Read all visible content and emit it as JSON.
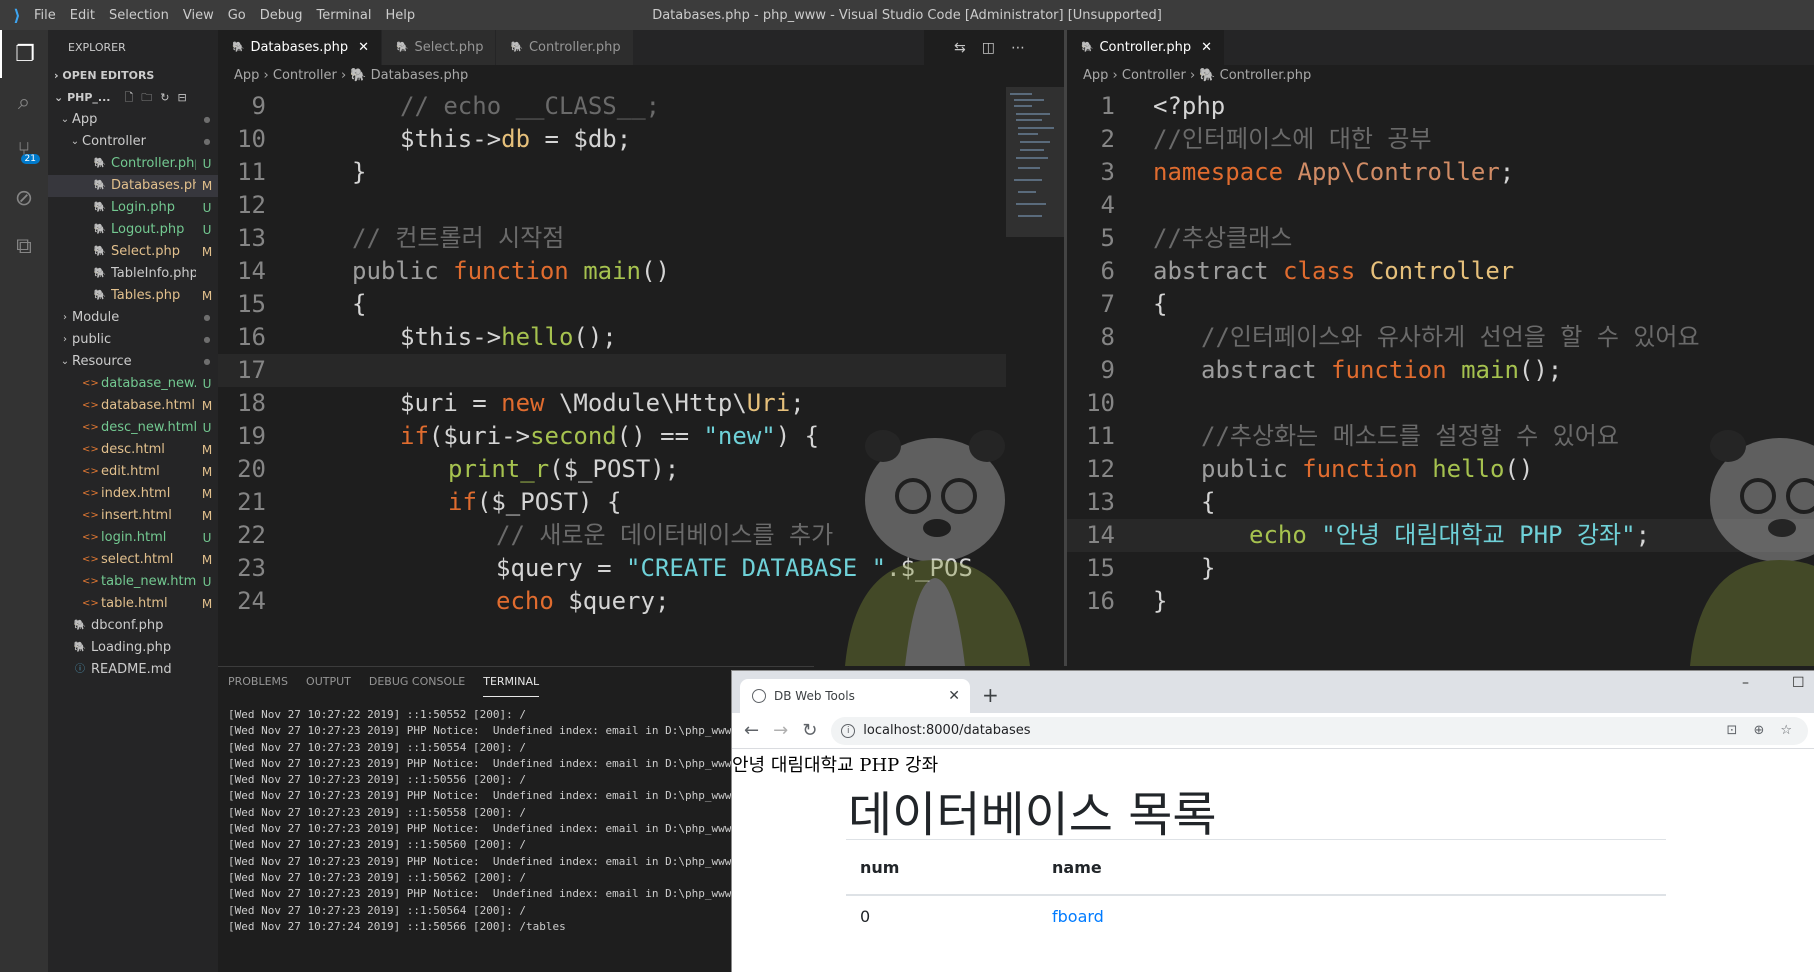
{
  "titlebar": {
    "menu": [
      "File",
      "Edit",
      "Selection",
      "View",
      "Go",
      "Debug",
      "Terminal",
      "Help"
    ],
    "title": "Databases.php - php_www - Visual Studio Code [Administrator] [Unsupported]"
  },
  "activity": {
    "scm_badge": "21"
  },
  "sidebar": {
    "header": "EXPLORER",
    "open_editors": "OPEN EDITORS",
    "workspace": "PHP_...",
    "tree": [
      {
        "name": "App",
        "type": "folder",
        "open": true,
        "depth": 1,
        "status": "dot"
      },
      {
        "name": "Controller",
        "type": "folder",
        "open": true,
        "depth": 2,
        "status": "dot"
      },
      {
        "name": "Controller.php",
        "type": "php",
        "depth": 3,
        "status": "U"
      },
      {
        "name": "Databases.php",
        "type": "php",
        "depth": 3,
        "status": "M",
        "selected": true
      },
      {
        "name": "Login.php",
        "type": "php",
        "depth": 3,
        "status": "U"
      },
      {
        "name": "Logout.php",
        "type": "php",
        "depth": 3,
        "status": "U"
      },
      {
        "name": "Select.php",
        "type": "php",
        "depth": 3,
        "status": "M"
      },
      {
        "name": "TableInfo.php",
        "type": "php",
        "depth": 3,
        "status": ""
      },
      {
        "name": "Tables.php",
        "type": "php",
        "depth": 3,
        "status": "M"
      },
      {
        "name": "Module",
        "type": "folder",
        "open": false,
        "depth": 1,
        "status": "dot"
      },
      {
        "name": "public",
        "type": "folder",
        "open": false,
        "depth": 1,
        "status": "dot"
      },
      {
        "name": "Resource",
        "type": "folder",
        "open": true,
        "depth": 1,
        "status": "dot"
      },
      {
        "name": "database_new....",
        "type": "html",
        "depth": 2,
        "status": "U"
      },
      {
        "name": "database.html",
        "type": "html",
        "depth": 2,
        "status": "M"
      },
      {
        "name": "desc_new.html",
        "type": "html",
        "depth": 2,
        "status": "U"
      },
      {
        "name": "desc.html",
        "type": "html",
        "depth": 2,
        "status": "M"
      },
      {
        "name": "edit.html",
        "type": "html",
        "depth": 2,
        "status": "M"
      },
      {
        "name": "index.html",
        "type": "html",
        "depth": 2,
        "status": "M"
      },
      {
        "name": "insert.html",
        "type": "html",
        "depth": 2,
        "status": "M"
      },
      {
        "name": "login.html",
        "type": "html",
        "depth": 2,
        "status": "U"
      },
      {
        "name": "select.html",
        "type": "html",
        "depth": 2,
        "status": "M"
      },
      {
        "name": "table_new.html",
        "type": "html",
        "depth": 2,
        "status": "U"
      },
      {
        "name": "table.html",
        "type": "html",
        "depth": 2,
        "status": "M"
      },
      {
        "name": "dbconf.php",
        "type": "php",
        "depth": 1,
        "status": ""
      },
      {
        "name": "Loading.php",
        "type": "php",
        "depth": 1,
        "status": ""
      },
      {
        "name": "README.md",
        "type": "info",
        "depth": 1,
        "status": ""
      }
    ]
  },
  "left_editor": {
    "tabs": [
      {
        "label": "Databases.php",
        "active": true
      },
      {
        "label": "Select.php",
        "active": false
      },
      {
        "label": "Controller.php",
        "active": false
      }
    ],
    "breadcrumb": [
      "App",
      "Controller",
      "Databases.php"
    ],
    "lines": [
      {
        "n": "9",
        "indent": 2,
        "tokens": [
          [
            "com",
            "// echo __CLASS__;"
          ]
        ]
      },
      {
        "n": "10",
        "indent": 2,
        "tokens": [
          [
            "var",
            "$this->"
          ],
          [
            "prop",
            "db"
          ],
          [
            "var",
            " = $db;"
          ]
        ]
      },
      {
        "n": "11",
        "indent": 1,
        "tokens": [
          [
            "var",
            "}"
          ]
        ]
      },
      {
        "n": "12",
        "indent": 0,
        "tokens": []
      },
      {
        "n": "13",
        "indent": 1,
        "tokens": [
          [
            "com",
            "// 컨트롤러 시작점"
          ]
        ]
      },
      {
        "n": "14",
        "indent": 1,
        "tokens": [
          [
            "mod",
            "public "
          ],
          [
            "key",
            "function "
          ],
          [
            "fn",
            "main"
          ],
          [
            "var",
            "()"
          ]
        ]
      },
      {
        "n": "15",
        "indent": 1,
        "tokens": [
          [
            "var",
            "{"
          ]
        ]
      },
      {
        "n": "16",
        "indent": 2,
        "tokens": [
          [
            "var",
            "$this->"
          ],
          [
            "fn",
            "hello"
          ],
          [
            "var",
            "();"
          ]
        ]
      },
      {
        "n": "17",
        "indent": 0,
        "tokens": [],
        "current": true
      },
      {
        "n": "18",
        "indent": 2,
        "tokens": [
          [
            "var",
            "$uri = "
          ],
          [
            "key",
            "new "
          ],
          [
            "var",
            "\\Module\\Http\\"
          ],
          [
            "prop",
            "Uri"
          ],
          [
            "var",
            ";"
          ]
        ]
      },
      {
        "n": "19",
        "indent": 2,
        "tokens": [
          [
            "key",
            "if"
          ],
          [
            "var",
            "($uri->"
          ],
          [
            "fn",
            "second"
          ],
          [
            "var",
            "() == "
          ],
          [
            "str",
            "\"new\""
          ],
          [
            "var",
            ") {"
          ]
        ]
      },
      {
        "n": "20",
        "indent": 3,
        "tokens": [
          [
            "fn",
            "print_r"
          ],
          [
            "var",
            "($_POST);"
          ]
        ]
      },
      {
        "n": "21",
        "indent": 3,
        "tokens": [
          [
            "key",
            "if"
          ],
          [
            "var",
            "($_POST) {"
          ]
        ]
      },
      {
        "n": "22",
        "indent": 4,
        "tokens": [
          [
            "com",
            "// 새로운 데이터베이스를 추가"
          ]
        ]
      },
      {
        "n": "23",
        "indent": 4,
        "tokens": [
          [
            "var",
            "$query = "
          ],
          [
            "str",
            "\"CREATE DATABASE \""
          ],
          [
            "var",
            ".$_POS"
          ]
        ]
      },
      {
        "n": "24",
        "indent": 4,
        "tokens": [
          [
            "key",
            "echo "
          ],
          [
            "var",
            "$query;"
          ]
        ]
      }
    ]
  },
  "right_editor": {
    "tabs": [
      {
        "label": "Controller.php",
        "active": true
      }
    ],
    "breadcrumb": [
      "App",
      "Controller",
      "Controller.php"
    ],
    "lines": [
      {
        "n": "1",
        "indent": 0,
        "tokens": [
          [
            "var",
            "<?php"
          ]
        ]
      },
      {
        "n": "2",
        "indent": 0,
        "tokens": [
          [
            "com",
            "//인터페이스에 대한 공부"
          ]
        ]
      },
      {
        "n": "3",
        "indent": 0,
        "tokens": [
          [
            "key",
            "namespace "
          ],
          [
            "ns",
            "App\\Controller"
          ],
          [
            "var",
            ";"
          ]
        ]
      },
      {
        "n": "4",
        "indent": 0,
        "tokens": []
      },
      {
        "n": "5",
        "indent": 0,
        "tokens": [
          [
            "com",
            "//추상클래스"
          ]
        ]
      },
      {
        "n": "6",
        "indent": 0,
        "tokens": [
          [
            "mod",
            "abstract "
          ],
          [
            "key",
            "class "
          ],
          [
            "prop",
            "Controller"
          ]
        ]
      },
      {
        "n": "7",
        "indent": 0,
        "tokens": [
          [
            "var",
            "{"
          ]
        ]
      },
      {
        "n": "8",
        "indent": 1,
        "tokens": [
          [
            "com",
            "//인터페이스와 유사하게 선언을 할 수 있어요"
          ]
        ]
      },
      {
        "n": "9",
        "indent": 1,
        "tokens": [
          [
            "mod",
            "abstract "
          ],
          [
            "key",
            "function "
          ],
          [
            "fn",
            "main"
          ],
          [
            "var",
            "();"
          ]
        ]
      },
      {
        "n": "10",
        "indent": 0,
        "tokens": []
      },
      {
        "n": "11",
        "indent": 1,
        "tokens": [
          [
            "com",
            "//추상화는 메소드를 설정할 수 있어요"
          ]
        ]
      },
      {
        "n": "12",
        "indent": 1,
        "tokens": [
          [
            "mod",
            "public "
          ],
          [
            "key",
            "function "
          ],
          [
            "fn",
            "hello"
          ],
          [
            "var",
            "()"
          ]
        ]
      },
      {
        "n": "13",
        "indent": 1,
        "tokens": [
          [
            "var",
            "{"
          ]
        ]
      },
      {
        "n": "14",
        "indent": 2,
        "tokens": [
          [
            "fn",
            "echo "
          ],
          [
            "str",
            "\"안녕 대림대학교 PHP 강좌\""
          ],
          [
            "var",
            ";"
          ]
        ],
        "current": true
      },
      {
        "n": "15",
        "indent": 1,
        "tokens": [
          [
            "var",
            "}"
          ]
        ]
      },
      {
        "n": "16",
        "indent": 0,
        "tokens": [
          [
            "var",
            "}"
          ]
        ]
      }
    ]
  },
  "panel": {
    "tabs": [
      "PROBLEMS",
      "OUTPUT",
      "DEBUG CONSOLE",
      "TERMINAL"
    ],
    "active": "TERMINAL",
    "lines": [
      "[Wed Nov 27 10:27:22 2019] ::1:50552 [200]: /",
      "[Wed Nov 27 10:27:23 2019] PHP Notice:  Undefined index: email in D:\\php_www",
      "[Wed Nov 27 10:27:23 2019] ::1:50554 [200]: /",
      "[Wed Nov 27 10:27:23 2019] PHP Notice:  Undefined index: email in D:\\php_www",
      "[Wed Nov 27 10:27:23 2019] ::1:50556 [200]: /",
      "[Wed Nov 27 10:27:23 2019] PHP Notice:  Undefined index: email in D:\\php_www",
      "[Wed Nov 27 10:27:23 2019] ::1:50558 [200]: /",
      "[Wed Nov 27 10:27:23 2019] PHP Notice:  Undefined index: email in D:\\php_www",
      "[Wed Nov 27 10:27:23 2019] ::1:50560 [200]: /",
      "[Wed Nov 27 10:27:23 2019] PHP Notice:  Undefined index: email in D:\\php_www",
      "[Wed Nov 27 10:27:23 2019] ::1:50562 [200]: /",
      "[Wed Nov 27 10:27:23 2019] PHP Notice:  Undefined index: email in D:\\php_www",
      "[Wed Nov 27 10:27:23 2019] ::1:50564 [200]: /",
      "[Wed Nov 27 10:27:24 2019] ::1:50566 [200]: /tables"
    ]
  },
  "browser": {
    "tab_title": "DB Web Tools",
    "url": "localhost:8000/databases",
    "hello_text": "안녕 대림대학교 PHP 강좌",
    "heading": "데이터베이스 목록",
    "columns": [
      "num",
      "name"
    ],
    "rows": [
      {
        "num": "0",
        "name": "fboard"
      }
    ]
  }
}
